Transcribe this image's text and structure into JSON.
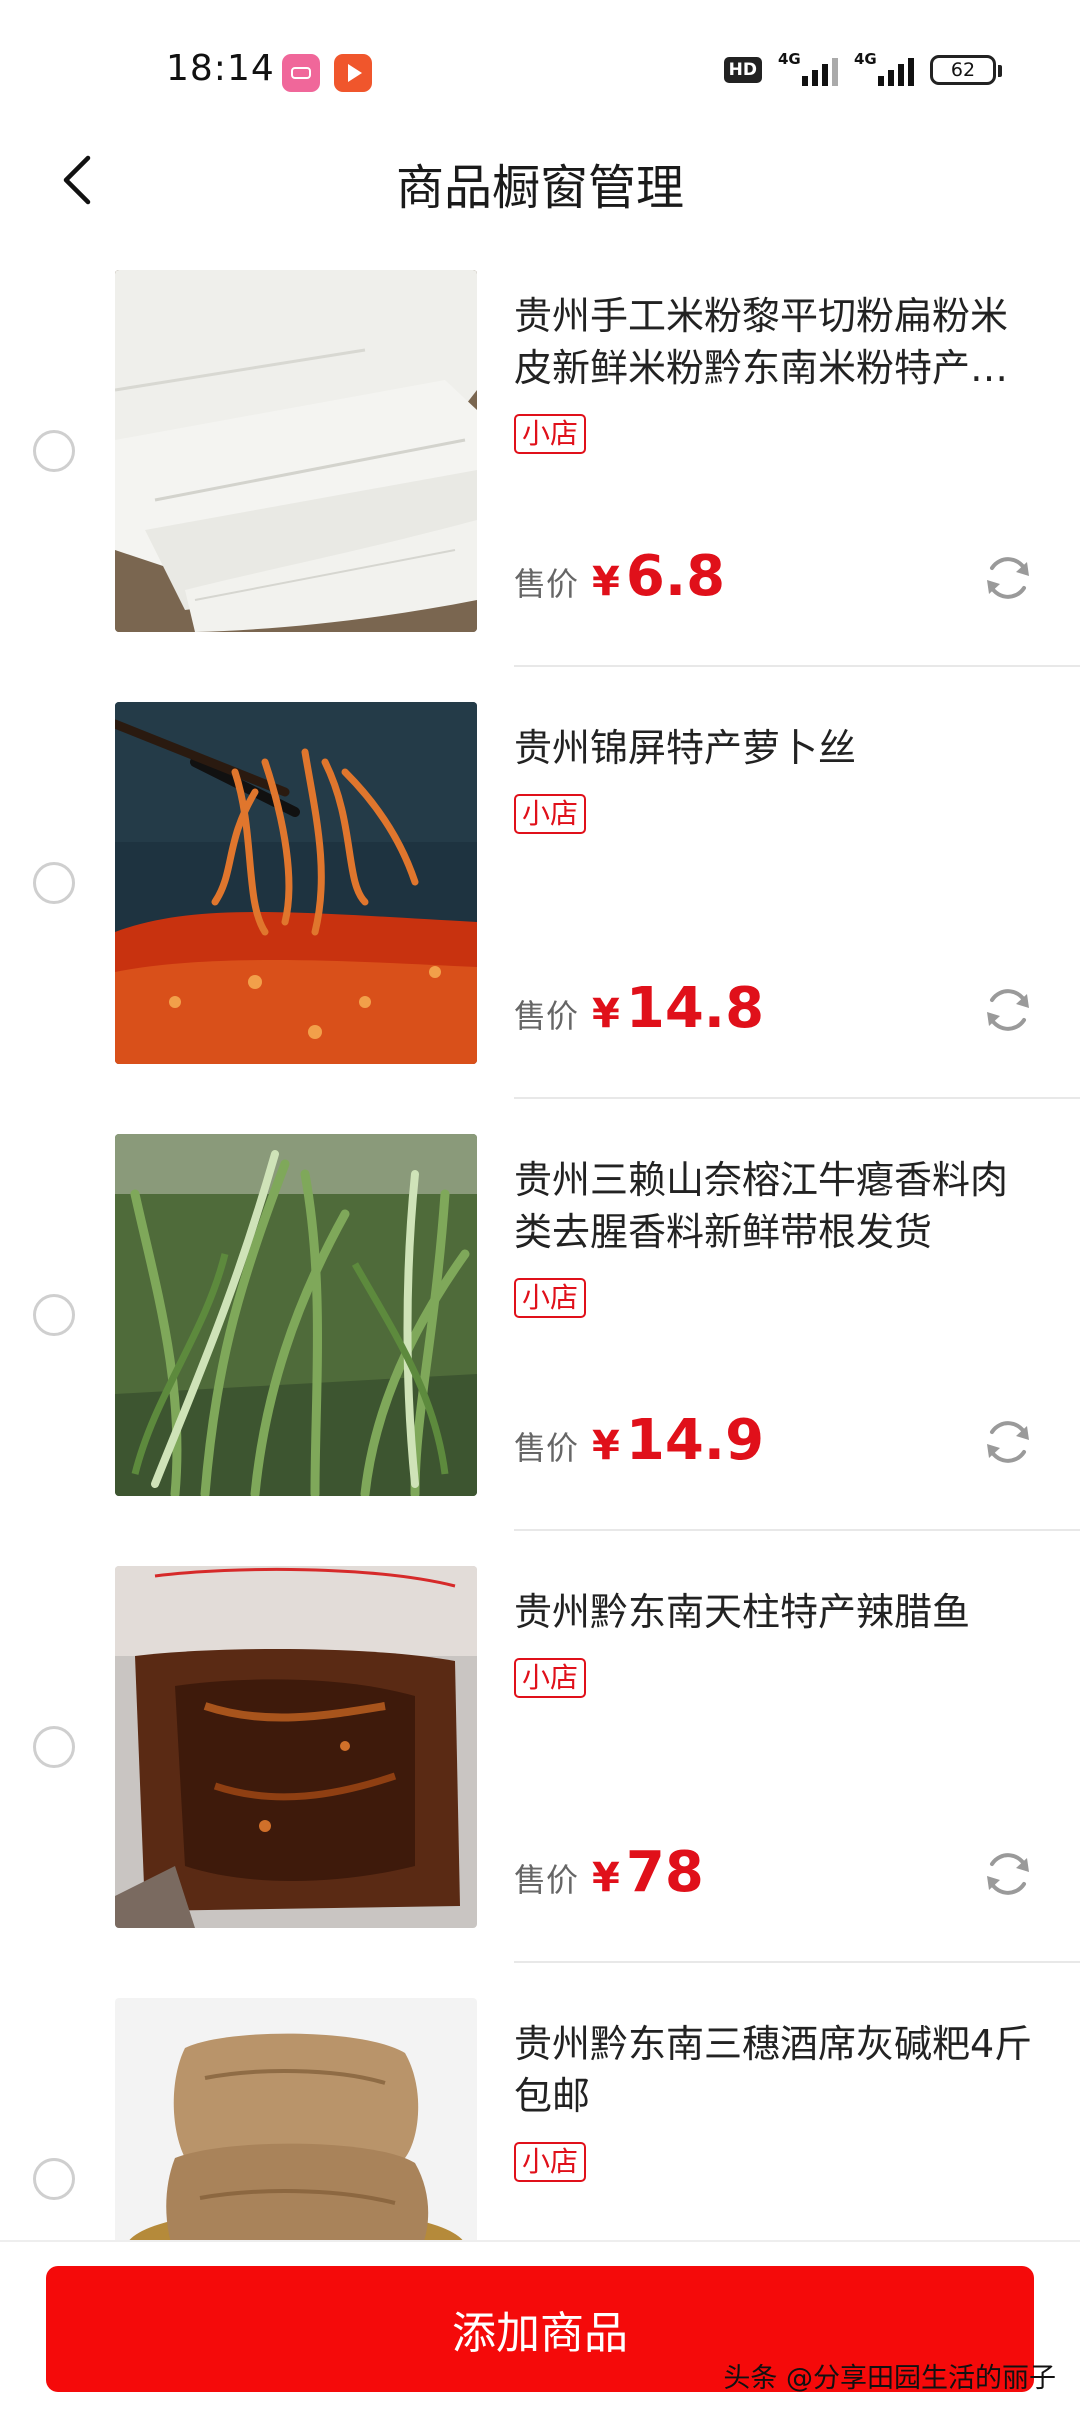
{
  "status": {
    "time": "18:14",
    "hd": "HD",
    "gen1": "4G",
    "gen2": "4G",
    "battery": "62"
  },
  "nav": {
    "title": "商品橱窗管理"
  },
  "items": [
    {
      "title": "贵州手工米粉黎平切粉扁粉米皮新鲜米粉黔东南米粉特产…",
      "tag": "小店",
      "price_label": "售价",
      "currency": "¥",
      "price": "6.8",
      "image": "rice-noodles"
    },
    {
      "title": "贵州锦屏特产萝卜丝",
      "tag": "小店",
      "price_label": "售价",
      "currency": "¥",
      "price": "14.8",
      "image": "spicy-radish"
    },
    {
      "title": "贵州三赖山奈榕江牛瘪香料肉类去腥香料新鲜带根发货",
      "tag": "小店",
      "price_label": "售价",
      "currency": "¥",
      "price": "14.9",
      "image": "herb-plants"
    },
    {
      "title": "贵州黔东南天柱特产辣腊鱼",
      "tag": "小店",
      "price_label": "售价",
      "currency": "¥",
      "price": "78",
      "image": "cured-fish"
    },
    {
      "title": "贵州黔东南三穗酒席灰碱粑4斤包邮",
      "tag": "小店",
      "price_label": "售价",
      "currency": "¥",
      "price": "",
      "image": "rice-cakes"
    }
  ],
  "bottom": {
    "add_button": "添加商品",
    "watermark": "头条 @分享田园生活的丽子"
  },
  "colors": {
    "accent": "#f50a0a",
    "price": "#e0101a"
  }
}
